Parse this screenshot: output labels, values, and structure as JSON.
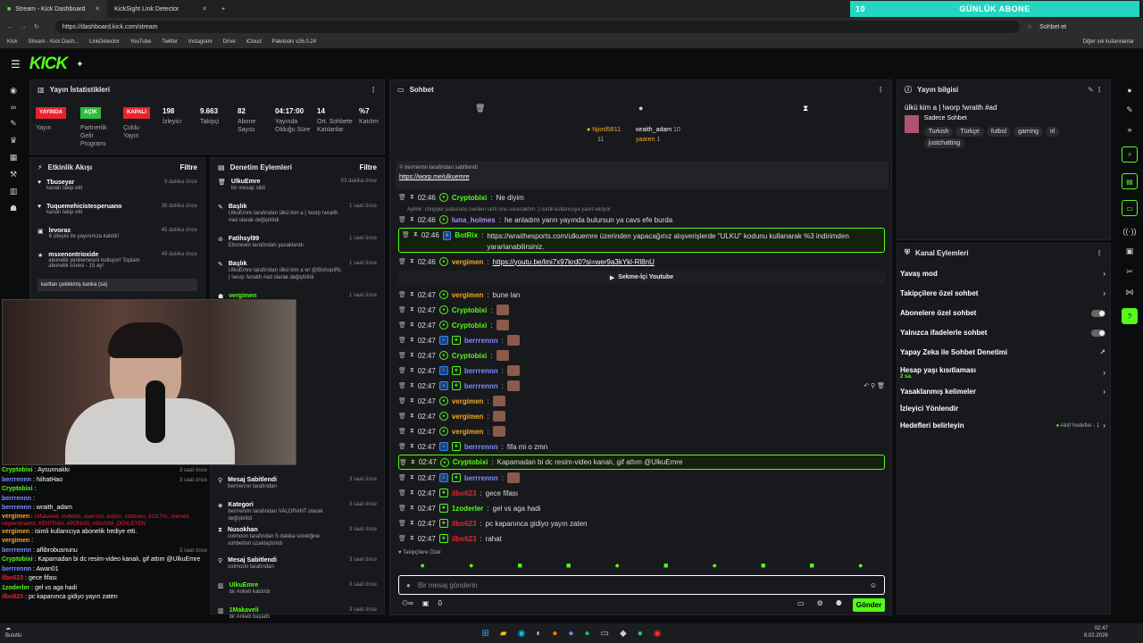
{
  "browser": {
    "tabs": [
      {
        "label": "Stream - Kick Dashboard"
      },
      {
        "label": "KickSight Link Detector"
      }
    ],
    "url": "https://dashboard.kick.com/stream",
    "bookmarks": [
      "Kick",
      "Stream - Kick Dash...",
      "LinkDetector",
      "YouTube",
      "Twitter",
      "Instagram",
      "Drive",
      "iCloud",
      "Paletools v26.0.24"
    ],
    "other_bookmarks": "Diğer sık kullanılanlar",
    "profile_label": "Sohbet et"
  },
  "overlay": {
    "count": "10",
    "label": "GÜNLÜK ABONE"
  },
  "stats": {
    "title": "Yayın İstatistikleri",
    "items": [
      {
        "pill": "YAYINDA",
        "pill_color": "#e8232e",
        "label": "Yayın"
      },
      {
        "pill": "AÇIK",
        "pill_color": "#2bbf3b",
        "label": "Partnerlik Gelir Programı"
      },
      {
        "pill": "KAPALI",
        "pill_color": "#e8232e",
        "label": "Çoklu Yayın"
      },
      {
        "value": "198",
        "label": "İzleyici"
      },
      {
        "value": "9.663",
        "label": "Takipçi"
      },
      {
        "value": "82",
        "label": "Abone Sayısı"
      },
      {
        "value": "04:17:00",
        "label": "Yayında Olduğu Süre"
      },
      {
        "value": "14",
        "label": "Ort. Sohbete Katılanlar"
      },
      {
        "value": "%7",
        "label": "Katılım"
      }
    ]
  },
  "activity": {
    "title": "Etkinlik Akışı",
    "filter": "Filtre",
    "items": [
      {
        "name": "Tbuseyar",
        "desc": "kanalı takip etti",
        "time": "9 dakika önce"
      },
      {
        "name": "Tuquemehicistesperuano",
        "desc": "kanalı takip etti",
        "time": "36 dakika önce"
      },
      {
        "name": "levorax",
        "desc": "6 izleyici ile yayınınıza katıldı!",
        "time": "45 dakika önce"
      },
      {
        "name": "msxenontrioxide",
        "desc": "abonelik yenilemesini kutluyor! Toplam abonelik süresi - 15 ay!",
        "time": "49 dakika önce"
      }
    ],
    "note": "karttan çekkkmiş kanka (sa)"
  },
  "moderation": {
    "title": "Denetim Eylemleri",
    "filter": "Filtre",
    "items": [
      {
        "name": "UlkuEmre",
        "desc": "bir mesajı sildi",
        "time": "53 dakika önce"
      },
      {
        "name": "Başlık",
        "desc": "UlkuEmre tarafından ülkü kim a | !worp !wraith #ad olarak değiştirildi",
        "time": "1 saat önce"
      },
      {
        "name": "Fatihsyl99",
        "desc": "Eboniven tarafından yasaklandı",
        "time": "1 saat önce"
      },
      {
        "name": "Başlık",
        "desc": "UlkuEmre tarafından ülkü kim a w/ @BishopIRL | !worp !wraith #ad olarak değiştirildi",
        "time": "1 saat önce"
      },
      {
        "name": "vergimen",
        "desc": "",
        "time": "1 saat önce"
      },
      {
        "name": "Mesaj Sabitlendi",
        "desc": "berrrennn tarafından",
        "time": "3 saat önce"
      },
      {
        "name": "Kategori",
        "desc": "berrrennn tarafından VALORANT olarak değiştirildi",
        "time": "3 saat önce"
      },
      {
        "name": "Nusokhan",
        "desc": "cotmoon tarafından 5 dakika süreliğine sohbetten uzaklaştırıldı",
        "time": "3 saat önce"
      },
      {
        "name": "Mesaj Sabitlendi",
        "desc": "cotmoon tarafından",
        "time": "3 saat önce"
      },
      {
        "name": "UlkuEmre",
        "desc": "bir Anketi kaldırdı",
        "time": "3 saat önce"
      },
      {
        "name": "1Makaveli",
        "desc": "bir Anketi başlattı",
        "time": "3 saat önce"
      }
    ]
  },
  "chat": {
    "title": "Sohbet",
    "top_users": [
      {
        "name": "Njord5811",
        "count": "11"
      },
      {
        "name": "wraith_adam",
        "count": "10"
      },
      {
        "name": "yaaren",
        "count": "1"
      }
    ],
    "pinned": {
      "by": "berrrennn tarafından sabitlendi",
      "link": "https://worp.me/ulkuemre"
    },
    "reply_hint": "Aytink: chopper patusunu nerden sirrli onu soracaktım :) isimli kullanıcıya yanıt veriyor",
    "youtube_label": "Sekme-İçi Youtube",
    "messages": [
      {
        "time": "02:46",
        "user": "Cryptobixi",
        "color": "#53fc18",
        "text": "Ne diyim"
      },
      {
        "time": "02:46",
        "user": "luna_holmes",
        "color": "#b388ff",
        "text": "he anladım yarın yayında bulursun ya cavs efe burda"
      },
      {
        "time": "02:46",
        "user": "BotRix",
        "color": "#53fc18",
        "text": "https://wraithesports.com/ulkuemre üzerinden yapacağınız alışverişlerde \"ULKU\" kodunu kullanarak %3 indirimden yararlanabilirsiniz."
      },
      {
        "time": "02:46",
        "user": "vergimen",
        "color": "#f5a623",
        "text": "https://youtu.be/lmi7x97krd0?si=wer9a3kYkl-Rl8nU"
      },
      {
        "time": "02:47",
        "user": "vergimen",
        "color": "#f5a623",
        "text": "bune lan"
      },
      {
        "time": "02:47",
        "user": "Cryptobixi",
        "color": "#53fc18",
        "text": ""
      },
      {
        "time": "02:47",
        "user": "Cryptobixi",
        "color": "#53fc18",
        "text": ""
      },
      {
        "time": "02:47",
        "user": "berrrennn",
        "color": "#7d8cff",
        "text": ""
      },
      {
        "time": "02:47",
        "user": "Cryptobixi",
        "color": "#53fc18",
        "text": ""
      },
      {
        "time": "02:47",
        "user": "berrrennn",
        "color": "#7d8cff",
        "text": ""
      },
      {
        "time": "02:47",
        "user": "berrrennn",
        "color": "#7d8cff",
        "text": ""
      },
      {
        "time": "02:47",
        "user": "vergimen",
        "color": "#f5a623",
        "text": ""
      },
      {
        "time": "02:47",
        "user": "vergimen",
        "color": "#f5a623",
        "text": ""
      },
      {
        "time": "02:47",
        "user": "vergimen",
        "color": "#f5a623",
        "text": ""
      },
      {
        "time": "02:47",
        "user": "berrrennn",
        "color": "#7d8cff",
        "text": "fifa mi o zmn"
      },
      {
        "time": "02:47",
        "user": "Cryptobixi",
        "color": "#53fc18",
        "text": "Kapamadan bi dc resim-video kanalı, gif attım @UlkuEmre"
      },
      {
        "time": "02:47",
        "user": "berrrennn",
        "color": "#7d8cff",
        "text": ""
      },
      {
        "time": "02:47",
        "user": "ilbo623",
        "color": "#e8232e",
        "text": "gece fifası"
      },
      {
        "time": "02:47",
        "user": "1zoderler",
        "color": "#53fc18",
        "text": "gel vs aga hadi"
      },
      {
        "time": "02:47",
        "user": "ilbo623",
        "color": "#e8232e",
        "text": "pc kapanınca gidiyo yayın zaten"
      },
      {
        "time": "02:47",
        "user": "ilbo623",
        "color": "#e8232e",
        "text": "rahat"
      }
    ],
    "followers_label": "Takipçilere Özel",
    "input_placeholder": "Bir mesaj gönderin",
    "send_label": "Gönder",
    "footer_count": "0"
  },
  "stream_info": {
    "title": "Yayın bilgisi",
    "stream_title": "ülkü kim a | !worp !wraith #ad",
    "category": "Sadece Sohbet",
    "tags": [
      "Turkish",
      "Türkçe",
      "futbol",
      "gaming",
      "irl",
      "justchatting"
    ]
  },
  "channel_actions": {
    "title": "Kanal Eylemleri",
    "items": [
      {
        "label": "Yavaş mod",
        "control": "chevron"
      },
      {
        "label": "Takipçilere özel sohbet",
        "control": "chevron"
      },
      {
        "label": "Abonelere özel sohbet",
        "control": "toggle"
      },
      {
        "label": "Yalnızca ifadelerle sohbet",
        "control": "toggle"
      },
      {
        "label": "Yapay Zeka ile Sohbet Denetimi",
        "control": "external"
      },
      {
        "label": "Hesap yaşı kısıtlaması",
        "sub": "2 sa.",
        "control": "chevron"
      },
      {
        "label": "Yasaklanmış kelimeler",
        "control": "chevron"
      },
      {
        "label": "İzleyici Yönlendir",
        "control": "none"
      },
      {
        "label": "Hedefleri belirleyin",
        "sub": "Aktif hedefler - 1",
        "control": "chevron"
      }
    ]
  },
  "lower_chat": [
    {
      "user": "Cryptobixi",
      "text": "Aysunnakki",
      "time": "3 saat önce"
    },
    {
      "user": "berrrennn",
      "text": "NihatHao",
      "time": "3 saat önce"
    },
    {
      "user": "Cryptobixi",
      "text": ""
    },
    {
      "user": "berrrennn",
      "text": ""
    },
    {
      "user": "berrrennn",
      "text": "wraith_adam"
    },
    {
      "user": "vergimen",
      "text": "1Makaveli, muhden, userismi, aslicm, cotmoon, 4111Tnl., merveli, migrenlimamit, XENTRAH, APONUN_ANASINI_DEHLEYEN"
    },
    {
      "user": "vergimen",
      "text": "isimli kullanıcıya abonelik hediye etti."
    },
    {
      "user": "vergimen",
      "text": ""
    },
    {
      "user": "berrrennn",
      "text": "aflibrobusnunu",
      "time": "3 saat önce"
    },
    {
      "user": "Cryptobixi",
      "text": "Kapamadan bi dc resim-video kanalı, gif attım @UlkuEmre"
    },
    {
      "user": "berrrennn",
      "text": "Awan01"
    },
    {
      "user": "ilbo623",
      "text": "gece fifası"
    },
    {
      "user": "1zoderler",
      "text": "gel vs aga hadi"
    },
    {
      "user": "ilbo623",
      "text": "pc kapanınca gidiyo yayın zaten"
    }
  ],
  "taskbar": {
    "time": "02:47",
    "date": "8.02.2026",
    "weather": "Bulutlu"
  }
}
